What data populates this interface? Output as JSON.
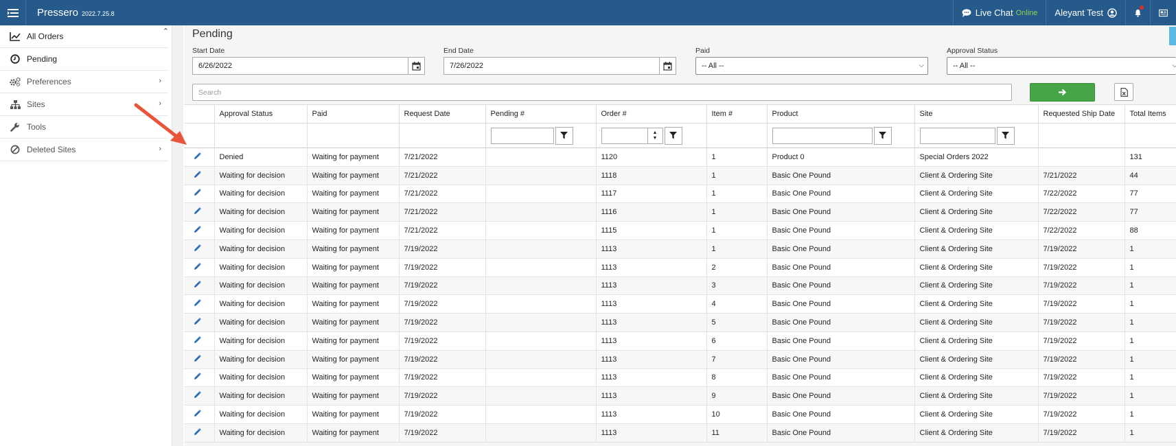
{
  "header": {
    "app_name": "Pressero",
    "version": "2022.7.25.8",
    "live_chat_label": "Live Chat",
    "live_chat_status": "Online",
    "user_name": "Aleyant Test"
  },
  "sidebar": {
    "items": [
      {
        "label": "All Orders",
        "icon": "chart-line-icon",
        "has_children": false
      },
      {
        "label": "Pending",
        "icon": "clock-icon",
        "has_children": false
      },
      {
        "label": "Preferences",
        "icon": "gears-icon",
        "has_children": true
      },
      {
        "label": "Sites",
        "icon": "sitemap-icon",
        "has_children": true
      },
      {
        "label": "Tools",
        "icon": "wrench-icon",
        "has_children": false
      },
      {
        "label": "Deleted Sites",
        "icon": "ban-icon",
        "has_children": true
      }
    ]
  },
  "page": {
    "title": "Pending"
  },
  "filters": {
    "start_date_label": "Start Date",
    "start_date_value": "6/26/2022",
    "end_date_label": "End Date",
    "end_date_value": "7/26/2022",
    "paid_label": "Paid",
    "paid_value": "-- All --",
    "approval_label": "Approval Status",
    "approval_value": "-- All --",
    "search_placeholder": "Search"
  },
  "table": {
    "columns": [
      "Approval Status",
      "Paid",
      "Request Date",
      "Pending #",
      "Order #",
      "Item #",
      "Product",
      "Site",
      "Requested Ship Date",
      "Total Items"
    ],
    "rows": [
      [
        "Denied",
        "Waiting for payment",
        "7/21/2022",
        "",
        "1120",
        "1",
        "Product 0",
        "Special Orders 2022",
        "",
        "131"
      ],
      [
        "Waiting for decision",
        "Waiting for payment",
        "7/21/2022",
        "",
        "1118",
        "1",
        "Basic One Pound",
        "Client & Ordering Site",
        "7/21/2022",
        "44"
      ],
      [
        "Waiting for decision",
        "Waiting for payment",
        "7/21/2022",
        "",
        "1117",
        "1",
        "Basic One Pound",
        "Client & Ordering Site",
        "7/22/2022",
        "77"
      ],
      [
        "Waiting for decision",
        "Waiting for payment",
        "7/21/2022",
        "",
        "1116",
        "1",
        "Basic One Pound",
        "Client & Ordering Site",
        "7/22/2022",
        "77"
      ],
      [
        "Waiting for decision",
        "Waiting for payment",
        "7/21/2022",
        "",
        "1115",
        "1",
        "Basic One Pound",
        "Client & Ordering Site",
        "7/22/2022",
        "88"
      ],
      [
        "Waiting for decision",
        "Waiting for payment",
        "7/19/2022",
        "",
        "1113",
        "1",
        "Basic One Pound",
        "Client & Ordering Site",
        "7/19/2022",
        "1"
      ],
      [
        "Waiting for decision",
        "Waiting for payment",
        "7/19/2022",
        "",
        "1113",
        "2",
        "Basic One Pound",
        "Client & Ordering Site",
        "7/19/2022",
        "1"
      ],
      [
        "Waiting for decision",
        "Waiting for payment",
        "7/19/2022",
        "",
        "1113",
        "3",
        "Basic One Pound",
        "Client & Ordering Site",
        "7/19/2022",
        "1"
      ],
      [
        "Waiting for decision",
        "Waiting for payment",
        "7/19/2022",
        "",
        "1113",
        "4",
        "Basic One Pound",
        "Client & Ordering Site",
        "7/19/2022",
        "1"
      ],
      [
        "Waiting for decision",
        "Waiting for payment",
        "7/19/2022",
        "",
        "1113",
        "5",
        "Basic One Pound",
        "Client & Ordering Site",
        "7/19/2022",
        "1"
      ],
      [
        "Waiting for decision",
        "Waiting for payment",
        "7/19/2022",
        "",
        "1113",
        "6",
        "Basic One Pound",
        "Client & Ordering Site",
        "7/19/2022",
        "1"
      ],
      [
        "Waiting for decision",
        "Waiting for payment",
        "7/19/2022",
        "",
        "1113",
        "7",
        "Basic One Pound",
        "Client & Ordering Site",
        "7/19/2022",
        "1"
      ],
      [
        "Waiting for decision",
        "Waiting for payment",
        "7/19/2022",
        "",
        "1113",
        "8",
        "Basic One Pound",
        "Client & Ordering Site",
        "7/19/2022",
        "1"
      ],
      [
        "Waiting for decision",
        "Waiting for payment",
        "7/19/2022",
        "",
        "1113",
        "9",
        "Basic One Pound",
        "Client & Ordering Site",
        "7/19/2022",
        "1"
      ],
      [
        "Waiting for decision",
        "Waiting for payment",
        "7/19/2022",
        "",
        "1113",
        "10",
        "Basic One Pound",
        "Client & Ordering Site",
        "7/19/2022",
        "1"
      ],
      [
        "Waiting for decision",
        "Waiting for payment",
        "7/19/2022",
        "",
        "1113",
        "11",
        "Basic One Pound",
        "Client & Ordering Site",
        "7/19/2022",
        "1"
      ]
    ]
  },
  "colors": {
    "header_bg": "#255a8a",
    "accent_green": "#46a546",
    "online_green": "#8fd14f",
    "edit_icon_blue": "#2a6db5",
    "annotation_arrow": "#e8553a"
  }
}
